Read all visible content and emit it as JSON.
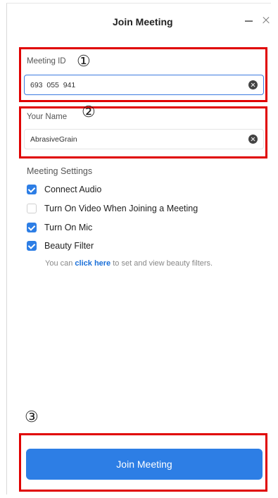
{
  "window": {
    "title": "Join Meeting",
    "minimize_label": "—",
    "close_label": "×"
  },
  "annotations": {
    "step1": "①",
    "step2": "②",
    "step3": "③",
    "highlight_color": "#e00000"
  },
  "meeting_id": {
    "label": "Meeting ID",
    "value": "693  055  941",
    "focused": true
  },
  "your_name": {
    "label": "Your Name",
    "value": "AbrasiveGrain"
  },
  "settings": {
    "title": "Meeting Settings",
    "options": [
      {
        "label": "Connect Audio",
        "checked": true
      },
      {
        "label": "Turn On Video When Joining a Meeting",
        "checked": false
      },
      {
        "label": "Turn On Mic",
        "checked": true
      },
      {
        "label": "Beauty Filter",
        "checked": true
      }
    ],
    "beauty_hint_prefix": "You can ",
    "beauty_hint_link": "click here",
    "beauty_hint_suffix": " to set and view beauty filters."
  },
  "join_button": {
    "label": "Join Meeting"
  },
  "colors": {
    "accent": "#2d7ee5",
    "link": "#1a6fd8"
  }
}
